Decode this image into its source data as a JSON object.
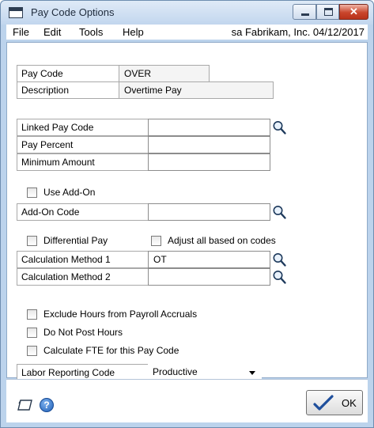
{
  "window": {
    "title": "Pay Code Options",
    "close_glyph": "✕"
  },
  "menu": {
    "items": [
      "File",
      "Edit",
      "Tools",
      "Help"
    ],
    "status": "sa  Fabrikam, Inc.  04/12/2017"
  },
  "pay_code": {
    "label": "Pay Code",
    "value": "OVER"
  },
  "description": {
    "label": "Description",
    "value": "Overtime Pay"
  },
  "linked_pay_code": {
    "label": "Linked Pay Code",
    "value": ""
  },
  "pay_percent": {
    "label": "Pay Percent",
    "value": ""
  },
  "minimum_amount": {
    "label": "Minimum Amount",
    "value": ""
  },
  "use_add_on": {
    "label": "Use Add-On",
    "checked": false
  },
  "add_on_code": {
    "label": "Add-On Code",
    "value": ""
  },
  "differential_pay": {
    "label": "Differential Pay",
    "checked": false
  },
  "adjust_all": {
    "label": "Adjust all based on codes",
    "checked": false
  },
  "calculation_method_1": {
    "label": "Calculation Method 1",
    "value": "OT"
  },
  "calculation_method_2": {
    "label": "Calculation Method 2",
    "value": ""
  },
  "exclude_hours": {
    "label": "Exclude Hours from Payroll Accruals",
    "checked": false
  },
  "do_not_post": {
    "label": "Do Not Post Hours",
    "checked": false
  },
  "calculate_fte": {
    "label": "Calculate FTE for this Pay Code",
    "checked": false
  },
  "labor_reporting": {
    "label": "Labor Reporting Code",
    "value": "Productive"
  },
  "footer": {
    "help_glyph": "?",
    "ok_label": "OK"
  },
  "icons": {
    "window": "window-icon",
    "lookup": "magnifier-lookup-icon",
    "note": "note-icon",
    "help": "help-icon",
    "ok": "checkmark-icon"
  },
  "colors": {
    "frame": "#bcd3ec",
    "close_button": "#c9452c",
    "help": "#1f5fb8",
    "checkmark": "#1f4f9c"
  }
}
